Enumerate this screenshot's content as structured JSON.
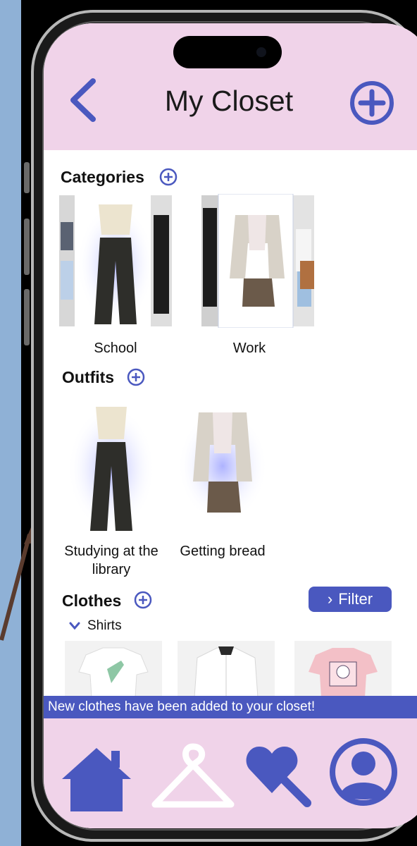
{
  "colors": {
    "accent": "#4a58bf",
    "header_bg": "#f0d3e9",
    "page_bg": "#8fb1d6"
  },
  "header": {
    "title": "My Closet",
    "back_icon": "chevron-left-icon",
    "add_icon": "plus-circle-icon"
  },
  "categories": {
    "title": "Categories",
    "items": [
      {
        "label": "School"
      },
      {
        "label": "Work"
      }
    ]
  },
  "outfits": {
    "title": "Outfits",
    "items": [
      {
        "label": "Studying at the library"
      },
      {
        "label": "Getting bread"
      }
    ]
  },
  "clothes": {
    "title": "Clothes",
    "filter_label": "Filter",
    "group_label": "Shirts",
    "items": [
      {
        "icon": "white-tshirt"
      },
      {
        "icon": "white-shirt"
      },
      {
        "icon": "pink-tshirt"
      }
    ]
  },
  "toast": {
    "message": "New clothes have been added to your closet!"
  },
  "nav": {
    "items": [
      {
        "icon": "home-icon"
      },
      {
        "icon": "hanger-icon"
      },
      {
        "icon": "heart-search-icon"
      },
      {
        "icon": "profile-icon"
      }
    ]
  }
}
